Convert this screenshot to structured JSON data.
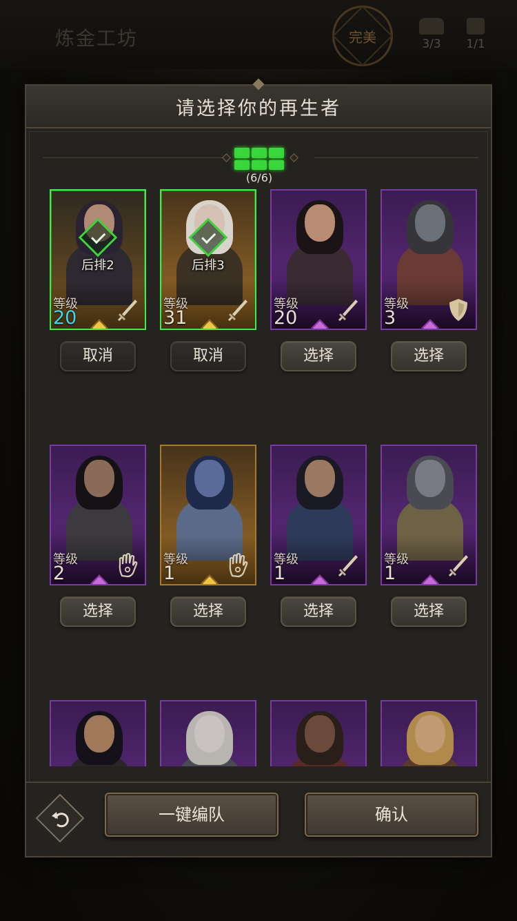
{
  "background": {
    "title": "炼金工坊",
    "badge": "完美",
    "resources": [
      {
        "label": "3/3",
        "icon": "chest-icon"
      },
      {
        "label": "1/1",
        "icon": "anvil-icon"
      }
    ]
  },
  "dialog": {
    "title": "请选择你的再生者",
    "team_slots": {
      "filled": 6,
      "total": 6,
      "label": "(6/6)",
      "color": "#39d63c"
    },
    "level_label": "等级",
    "heroes": [
      {
        "level": "20",
        "class_icon": "sword-icon",
        "frame": "purple",
        "selected": true,
        "position": "后排2",
        "button": "取消",
        "level_color": "#3ed6ec"
      },
      {
        "level": "31",
        "class_icon": "sword-icon",
        "frame": "gold",
        "selected": true,
        "position": "后排3",
        "button": "取消"
      },
      {
        "level": "20",
        "class_icon": "sword-icon",
        "frame": "purple",
        "selected": false,
        "button": "选择"
      },
      {
        "level": "3",
        "class_icon": "shield-icon",
        "frame": "purple",
        "selected": false,
        "button": "选择"
      },
      {
        "level": "2",
        "class_icon": "hand-icon",
        "frame": "purple",
        "selected": false,
        "button": "选择"
      },
      {
        "level": "1",
        "class_icon": "hand-icon",
        "frame": "gold",
        "selected": false,
        "button": "选择"
      },
      {
        "level": "1",
        "class_icon": "sword-icon",
        "frame": "purple",
        "selected": false,
        "button": "选择"
      },
      {
        "level": "1",
        "class_icon": "sword-icon",
        "frame": "purple",
        "selected": false,
        "button": "选择"
      },
      {
        "frame": "purple",
        "partial": true
      },
      {
        "frame": "purple",
        "partial": true
      },
      {
        "frame": "purple",
        "partial": true
      },
      {
        "frame": "purple",
        "partial": true
      }
    ]
  },
  "bottom": {
    "auto_team": "一键编队",
    "confirm": "确认",
    "back_icon": "undo-arrow-icon"
  }
}
